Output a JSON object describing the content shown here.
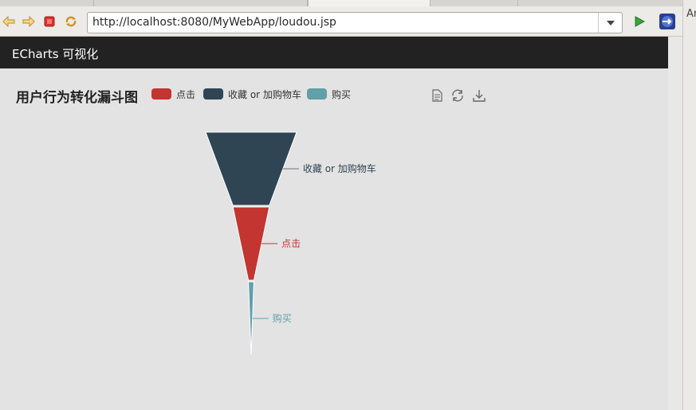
{
  "browser": {
    "url": "http://localhost:8080/MyWebApp/loudou.jsp",
    "side_label": "Ar"
  },
  "page": {
    "brand": "ECharts 可视化"
  },
  "chart_data": {
    "type": "funnel",
    "title": "用户行为转化漏斗图",
    "categories": [
      "收藏 or 加购物车",
      "点击",
      "购买"
    ],
    "values": [
      100,
      40,
      6
    ],
    "colors": [
      "#2f4554",
      "#c23531",
      "#61a0a8"
    ],
    "legend": [
      {
        "name": "点击",
        "color": "#c23531"
      },
      {
        "name": "收藏 or 加购物车",
        "color": "#2f4554"
      },
      {
        "name": "购买",
        "color": "#61a0a8"
      }
    ],
    "legend_position": "top",
    "sort": "descending"
  }
}
